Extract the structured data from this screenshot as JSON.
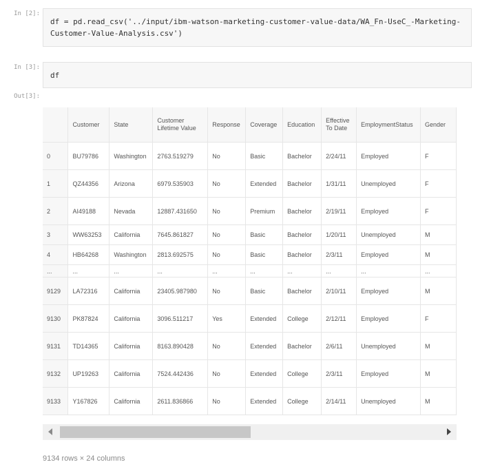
{
  "cells": [
    {
      "prompt": "In [2]:",
      "code": "df = pd.read_csv('../input/ibm-watson-marketing-customer-value-data/WA_Fn-UseC_-Marketing-Customer-Value-Analysis.csv')"
    },
    {
      "prompt": "In [3]:",
      "code": "df"
    }
  ],
  "output_prompt": "Out[3]:",
  "table": {
    "columns": [
      "",
      "Customer",
      "State",
      "Customer Lifetime Value",
      "Response",
      "Coverage",
      "Education",
      "Effective To Date",
      "EmploymentStatus",
      "Gender"
    ],
    "rows": [
      [
        "0",
        "BU79786",
        "Washington",
        "2763.519279",
        "No",
        "Basic",
        "Bachelor",
        "2/24/11",
        "Employed",
        "F"
      ],
      [
        "1",
        "QZ44356",
        "Arizona",
        "6979.535903",
        "No",
        "Extended",
        "Bachelor",
        "1/31/11",
        "Unemployed",
        "F"
      ],
      [
        "2",
        "AI49188",
        "Nevada",
        "12887.431650",
        "No",
        "Premium",
        "Bachelor",
        "2/19/11",
        "Employed",
        "F"
      ],
      [
        "3",
        "WW63253",
        "California",
        "7645.861827",
        "No",
        "Basic",
        "Bachelor",
        "1/20/11",
        "Unemployed",
        "M"
      ],
      [
        "4",
        "HB64268",
        "Washington",
        "2813.692575",
        "No",
        "Basic",
        "Bachelor",
        "2/3/11",
        "Employed",
        "M"
      ],
      [
        "...",
        "...",
        "...",
        "...",
        "...",
        "...",
        "...",
        "...",
        "...",
        "..."
      ],
      [
        "9129",
        "LA72316",
        "California",
        "23405.987980",
        "No",
        "Basic",
        "Bachelor",
        "2/10/11",
        "Employed",
        "M"
      ],
      [
        "9130",
        "PK87824",
        "California",
        "3096.511217",
        "Yes",
        "Extended",
        "College",
        "2/12/11",
        "Employed",
        "F"
      ],
      [
        "9131",
        "TD14365",
        "California",
        "8163.890428",
        "No",
        "Extended",
        "Bachelor",
        "2/6/11",
        "Unemployed",
        "M"
      ],
      [
        "9132",
        "UP19263",
        "California",
        "7524.442436",
        "No",
        "Extended",
        "College",
        "2/3/11",
        "Employed",
        "M"
      ],
      [
        "9133",
        "Y167826",
        "California",
        "2611.836866",
        "No",
        "Extended",
        "College",
        "2/14/11",
        "Unemployed",
        "M"
      ]
    ]
  },
  "shape_text": "9134 rows × 24 columns"
}
